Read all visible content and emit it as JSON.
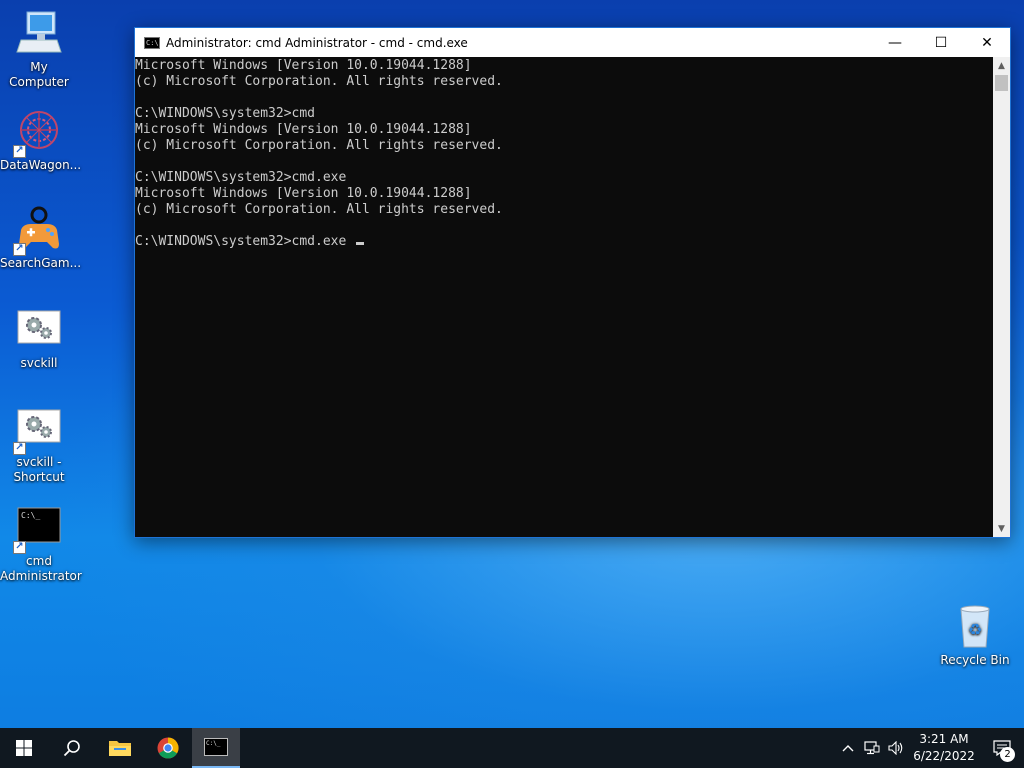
{
  "desktop": {
    "icons": [
      {
        "label": "My Computer",
        "icon": "computer-icon"
      },
      {
        "label": "DataWagon...",
        "icon": "datawagon-icon"
      },
      {
        "label": "SearchGam...",
        "icon": "gamepad-icon"
      },
      {
        "label": "svckill",
        "icon": "gears-icon"
      },
      {
        "label": "svckill - Shortcut",
        "icon": "gears-icon"
      },
      {
        "label": "cmd Administrator",
        "icon": "cmd-icon"
      },
      {
        "label": "Recycle Bin",
        "icon": "recycle-bin-icon"
      }
    ]
  },
  "window": {
    "title": "Administrator: cmd Administrator - cmd - cmd.exe",
    "minimize": "—",
    "maximize": "☐",
    "close": "✕",
    "console_lines": [
      "Microsoft Windows [Version 10.0.19044.1288]",
      "(c) Microsoft Corporation. All rights reserved.",
      "",
      "C:\\WINDOWS\\system32>cmd",
      "Microsoft Windows [Version 10.0.19044.1288]",
      "(c) Microsoft Corporation. All rights reserved.",
      "",
      "C:\\WINDOWS\\system32>cmd.exe",
      "Microsoft Windows [Version 10.0.19044.1288]",
      "(c) Microsoft Corporation. All rights reserved.",
      "",
      "C:\\WINDOWS\\system32>cmd.exe "
    ]
  },
  "taskbar": {
    "buttons": [
      "start-icon",
      "search-icon",
      "file-explorer-icon",
      "chrome-icon",
      "cmd-icon"
    ],
    "time": "3:21 AM",
    "date": "6/22/2022",
    "notification_count": "2"
  }
}
